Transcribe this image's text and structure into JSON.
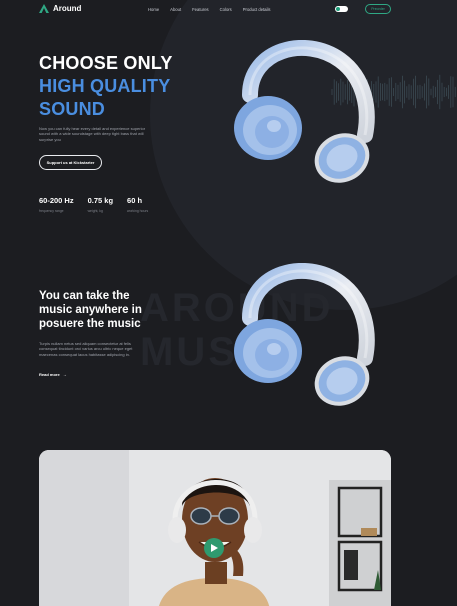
{
  "nav": {
    "logo": "Around",
    "menu": [
      "Home",
      "About",
      "Features",
      "Colors",
      "Product details"
    ],
    "theme_left": "",
    "theme_right": "",
    "button": "Preorder"
  },
  "hero": {
    "title_lines": [
      "CHOOSE ONLY",
      "HIGH QUALITY",
      "SOUND"
    ],
    "text": "Now you can fully hear every detail and experience superior sound with a wide soundstage with deep tight bass that will surprise you",
    "cta": "Support us at Kickstarter",
    "stats": [
      {
        "value": "60-200 Hz",
        "label": "frequency range"
      },
      {
        "value": "0.75 kg",
        "label": "weight, kg"
      },
      {
        "value": "60 h",
        "label": "working hours"
      }
    ]
  },
  "section2": {
    "ghost_lines": [
      "AROUND",
      "MUSIC"
    ],
    "title": "You can take the music anywhere in posuere the music",
    "text": "Turpis nullam netus sed aliquam consectetur at felis consequat tincidunt orci varius arcu ultric neque eget maecenas consequat lacus habitasse adipiscing in.",
    "read_more": "Read more",
    "read_more_arrow": "→"
  },
  "colors": {
    "accent_blue": "#4a8ee0",
    "accent_green": "#2fa884",
    "background": "#1c1d21"
  },
  "icons": {
    "logo": "triangle-logo-icon",
    "play": "play-icon",
    "headphones": "headphones-image"
  }
}
